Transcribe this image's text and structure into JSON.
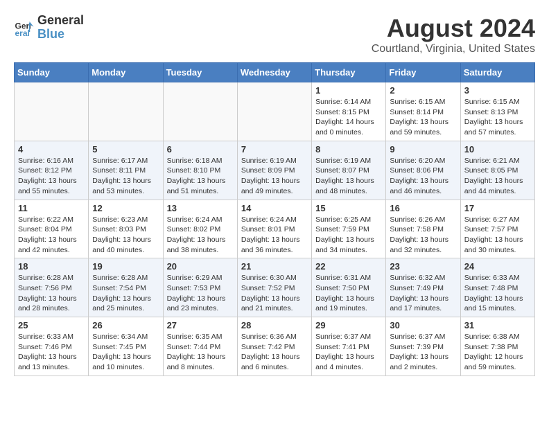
{
  "logo": {
    "line1": "General",
    "line2": "Blue"
  },
  "title": "August 2024",
  "subtitle": "Courtland, Virginia, United States",
  "days_of_week": [
    "Sunday",
    "Monday",
    "Tuesday",
    "Wednesday",
    "Thursday",
    "Friday",
    "Saturday"
  ],
  "weeks": [
    [
      {
        "day": "",
        "info": ""
      },
      {
        "day": "",
        "info": ""
      },
      {
        "day": "",
        "info": ""
      },
      {
        "day": "",
        "info": ""
      },
      {
        "day": "1",
        "info": "Sunrise: 6:14 AM\nSunset: 8:15 PM\nDaylight: 14 hours\nand 0 minutes."
      },
      {
        "day": "2",
        "info": "Sunrise: 6:15 AM\nSunset: 8:14 PM\nDaylight: 13 hours\nand 59 minutes."
      },
      {
        "day": "3",
        "info": "Sunrise: 6:15 AM\nSunset: 8:13 PM\nDaylight: 13 hours\nand 57 minutes."
      }
    ],
    [
      {
        "day": "4",
        "info": "Sunrise: 6:16 AM\nSunset: 8:12 PM\nDaylight: 13 hours\nand 55 minutes."
      },
      {
        "day": "5",
        "info": "Sunrise: 6:17 AM\nSunset: 8:11 PM\nDaylight: 13 hours\nand 53 minutes."
      },
      {
        "day": "6",
        "info": "Sunrise: 6:18 AM\nSunset: 8:10 PM\nDaylight: 13 hours\nand 51 minutes."
      },
      {
        "day": "7",
        "info": "Sunrise: 6:19 AM\nSunset: 8:09 PM\nDaylight: 13 hours\nand 49 minutes."
      },
      {
        "day": "8",
        "info": "Sunrise: 6:19 AM\nSunset: 8:07 PM\nDaylight: 13 hours\nand 48 minutes."
      },
      {
        "day": "9",
        "info": "Sunrise: 6:20 AM\nSunset: 8:06 PM\nDaylight: 13 hours\nand 46 minutes."
      },
      {
        "day": "10",
        "info": "Sunrise: 6:21 AM\nSunset: 8:05 PM\nDaylight: 13 hours\nand 44 minutes."
      }
    ],
    [
      {
        "day": "11",
        "info": "Sunrise: 6:22 AM\nSunset: 8:04 PM\nDaylight: 13 hours\nand 42 minutes."
      },
      {
        "day": "12",
        "info": "Sunrise: 6:23 AM\nSunset: 8:03 PM\nDaylight: 13 hours\nand 40 minutes."
      },
      {
        "day": "13",
        "info": "Sunrise: 6:24 AM\nSunset: 8:02 PM\nDaylight: 13 hours\nand 38 minutes."
      },
      {
        "day": "14",
        "info": "Sunrise: 6:24 AM\nSunset: 8:01 PM\nDaylight: 13 hours\nand 36 minutes."
      },
      {
        "day": "15",
        "info": "Sunrise: 6:25 AM\nSunset: 7:59 PM\nDaylight: 13 hours\nand 34 minutes."
      },
      {
        "day": "16",
        "info": "Sunrise: 6:26 AM\nSunset: 7:58 PM\nDaylight: 13 hours\nand 32 minutes."
      },
      {
        "day": "17",
        "info": "Sunrise: 6:27 AM\nSunset: 7:57 PM\nDaylight: 13 hours\nand 30 minutes."
      }
    ],
    [
      {
        "day": "18",
        "info": "Sunrise: 6:28 AM\nSunset: 7:56 PM\nDaylight: 13 hours\nand 28 minutes."
      },
      {
        "day": "19",
        "info": "Sunrise: 6:28 AM\nSunset: 7:54 PM\nDaylight: 13 hours\nand 25 minutes."
      },
      {
        "day": "20",
        "info": "Sunrise: 6:29 AM\nSunset: 7:53 PM\nDaylight: 13 hours\nand 23 minutes."
      },
      {
        "day": "21",
        "info": "Sunrise: 6:30 AM\nSunset: 7:52 PM\nDaylight: 13 hours\nand 21 minutes."
      },
      {
        "day": "22",
        "info": "Sunrise: 6:31 AM\nSunset: 7:50 PM\nDaylight: 13 hours\nand 19 minutes."
      },
      {
        "day": "23",
        "info": "Sunrise: 6:32 AM\nSunset: 7:49 PM\nDaylight: 13 hours\nand 17 minutes."
      },
      {
        "day": "24",
        "info": "Sunrise: 6:33 AM\nSunset: 7:48 PM\nDaylight: 13 hours\nand 15 minutes."
      }
    ],
    [
      {
        "day": "25",
        "info": "Sunrise: 6:33 AM\nSunset: 7:46 PM\nDaylight: 13 hours\nand 13 minutes."
      },
      {
        "day": "26",
        "info": "Sunrise: 6:34 AM\nSunset: 7:45 PM\nDaylight: 13 hours\nand 10 minutes."
      },
      {
        "day": "27",
        "info": "Sunrise: 6:35 AM\nSunset: 7:44 PM\nDaylight: 13 hours\nand 8 minutes."
      },
      {
        "day": "28",
        "info": "Sunrise: 6:36 AM\nSunset: 7:42 PM\nDaylight: 13 hours\nand 6 minutes."
      },
      {
        "day": "29",
        "info": "Sunrise: 6:37 AM\nSunset: 7:41 PM\nDaylight: 13 hours\nand 4 minutes."
      },
      {
        "day": "30",
        "info": "Sunrise: 6:37 AM\nSunset: 7:39 PM\nDaylight: 13 hours\nand 2 minutes."
      },
      {
        "day": "31",
        "info": "Sunrise: 6:38 AM\nSunset: 7:38 PM\nDaylight: 12 hours\nand 59 minutes."
      }
    ]
  ]
}
